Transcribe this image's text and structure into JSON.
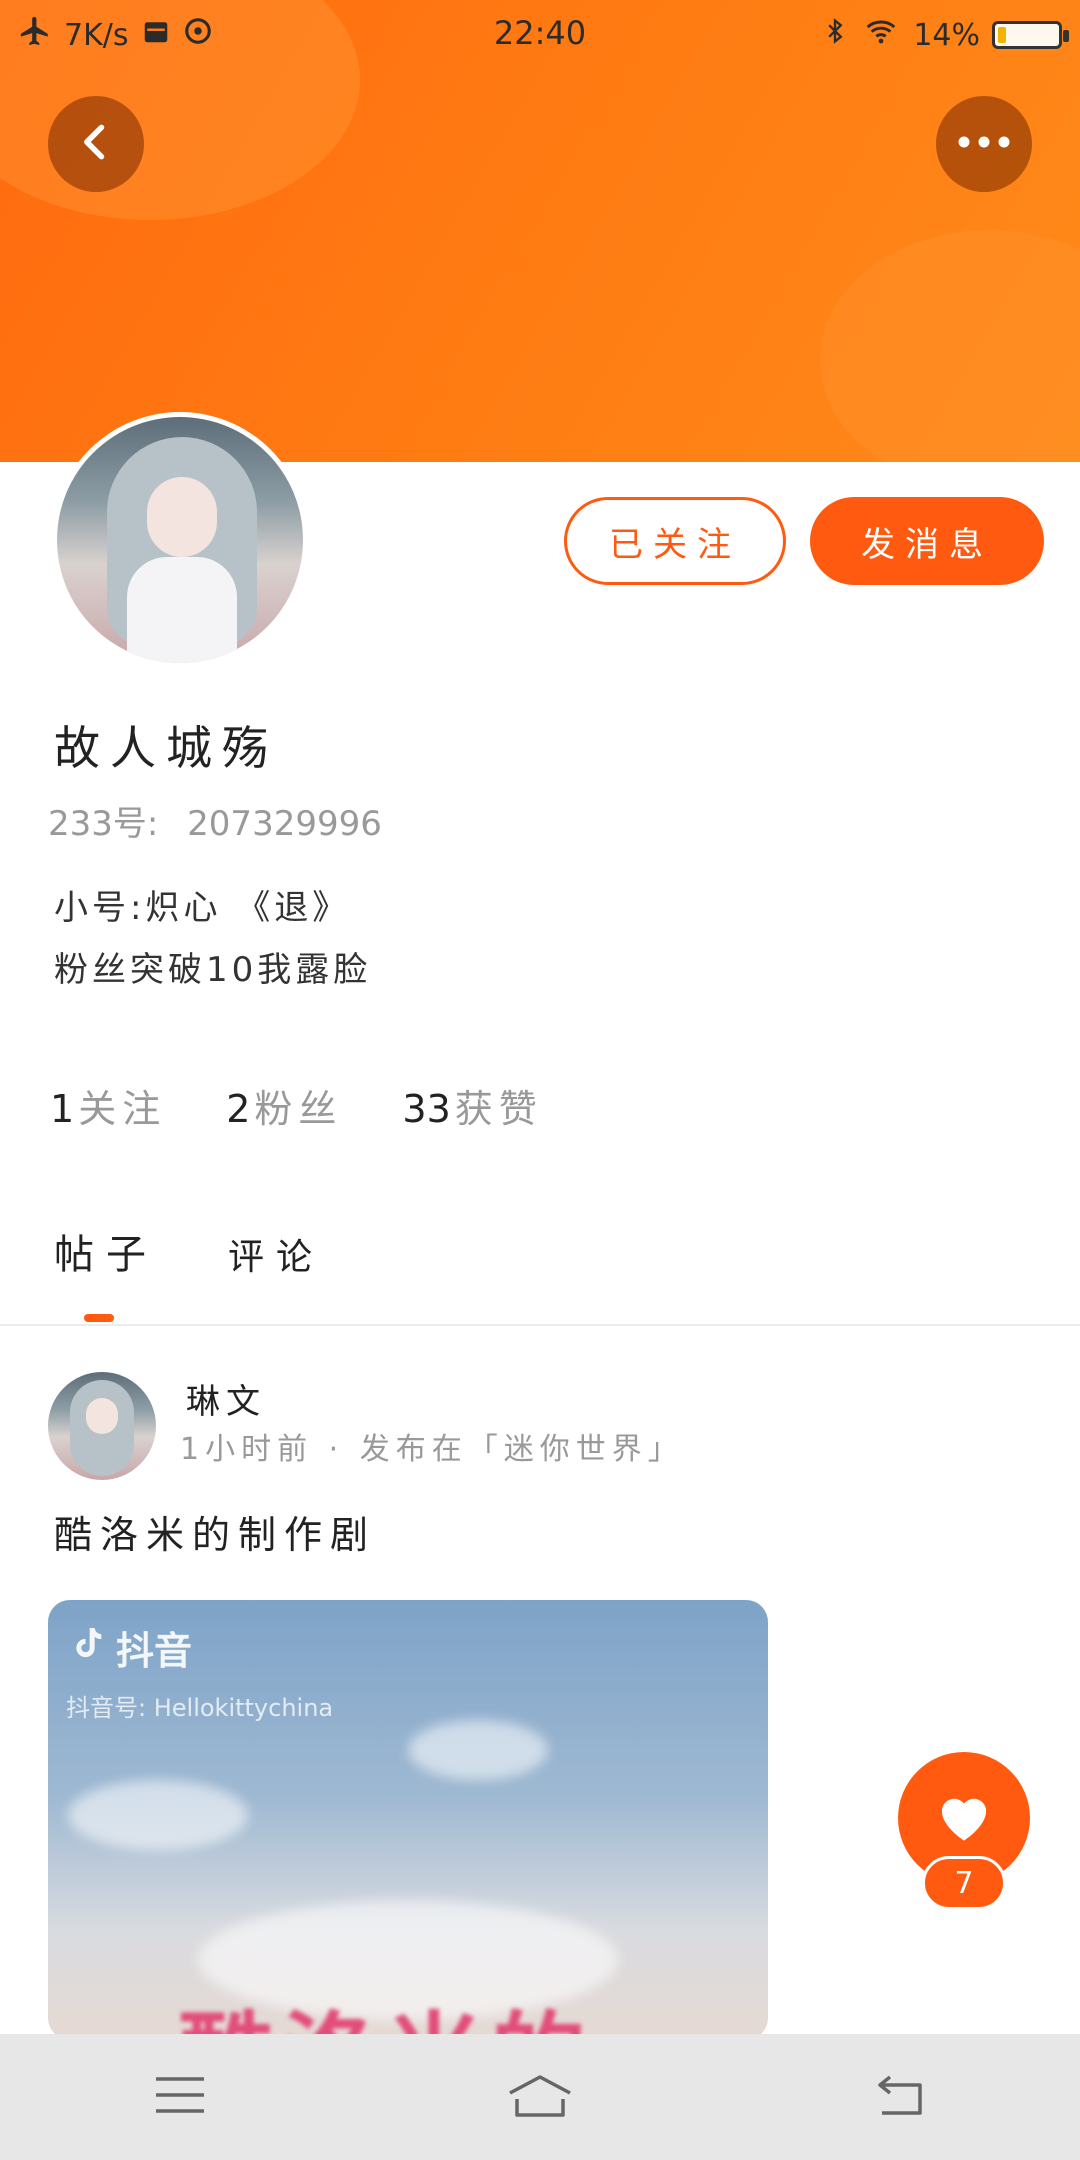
{
  "status_bar": {
    "speed": "7K/s",
    "time": "22:40",
    "battery": "14%",
    "battery_level": 0.14
  },
  "header": {
    "back_icon": "chevron-left-icon",
    "more_icon": "more-horizontal-icon"
  },
  "profile": {
    "name": "故人城殇",
    "uid_label": "233号:",
    "uid_value": "207329996",
    "bio_line1": "小号:炽心 《退》",
    "bio_line2": "粉丝突破10我露脸",
    "followed_button": "已关注",
    "message_button": "发消息"
  },
  "stats": [
    {
      "num": "1",
      "label": "关注"
    },
    {
      "num": "2",
      "label": "粉丝"
    },
    {
      "num": "33",
      "label": "获赞"
    }
  ],
  "tabs": [
    {
      "label": "帖子",
      "active": true
    },
    {
      "label": "评论",
      "active": false
    }
  ],
  "post": {
    "author": "琳文",
    "meta": "1小时前 · 发布在「迷你世界」",
    "title": "酷洛米的制作剧",
    "watermark_app": "抖音",
    "watermark_id": "抖音号: Hellokittychina",
    "overlay_text": "酷洛米的"
  },
  "like": {
    "count": "7",
    "icon": "heart-icon"
  },
  "colors": {
    "accent": "#ff5a10",
    "header": "#ff7a12"
  },
  "nav_bar": {
    "menu_icon": "menu-icon",
    "home_icon": "home-icon",
    "back_icon": "back-arrow-icon"
  }
}
